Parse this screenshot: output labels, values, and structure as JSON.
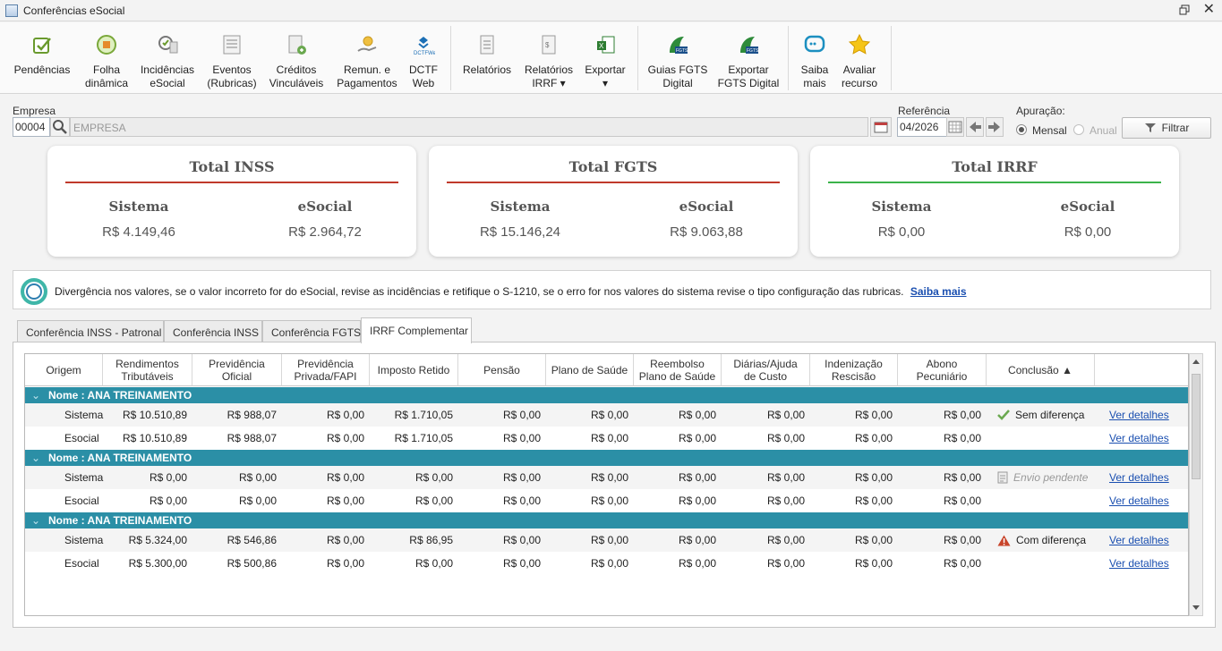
{
  "window": {
    "title": "Conferências eSocial"
  },
  "ribbon": [
    {
      "id": "pendencias",
      "lines": [
        "Pendências"
      ],
      "icon": "pending-check-icon"
    },
    {
      "id": "folha",
      "lines": [
        "Folha",
        "dinâmica"
      ],
      "icon": "payroll-icon"
    },
    {
      "id": "incidencias",
      "lines": [
        "Incidências",
        "eSocial"
      ],
      "icon": "incidence-icon"
    },
    {
      "id": "eventos",
      "lines": [
        "Eventos",
        "(Rubricas)"
      ],
      "icon": "events-list-icon"
    },
    {
      "id": "creditos",
      "lines": [
        "Créditos",
        "Vinculáveis"
      ],
      "icon": "credits-doc-icon"
    },
    {
      "id": "remun",
      "lines": [
        "Remun. e",
        "Pagamentos"
      ],
      "icon": "payment-hand-icon"
    },
    {
      "id": "dctf",
      "lines": [
        "DCTF",
        "Web"
      ],
      "icon": "dctfweb-icon"
    },
    {
      "id": "relatorios",
      "lines": [
        "Relatórios"
      ],
      "icon": "report-icon"
    },
    {
      "id": "relatorios_irrf",
      "lines": [
        "Relatórios",
        "IRRF ▾"
      ],
      "icon": "report-irrf-icon"
    },
    {
      "id": "exportar",
      "lines": [
        "Exportar",
        "▾"
      ],
      "icon": "excel-export-icon"
    },
    {
      "id": "guias_fgts",
      "lines": [
        "Guias FGTS",
        "Digital"
      ],
      "icon": "fgts-guide-icon"
    },
    {
      "id": "exportar_fgts",
      "lines": [
        "Exportar",
        "FGTS Digital"
      ],
      "icon": "fgts-export-icon"
    },
    {
      "id": "saiba",
      "lines": [
        "Saiba",
        "mais"
      ],
      "icon": "chat-info-icon"
    },
    {
      "id": "avaliar",
      "lines": [
        "Avaliar",
        "recurso"
      ],
      "icon": "star-icon"
    }
  ],
  "filters": {
    "empresa_label": "Empresa",
    "empresa_code": "00004",
    "empresa_name": "EMPRESA",
    "referencia_label": "Referência",
    "referencia_value": "04/2026",
    "apuracao_label": "Apuração:",
    "mensal_label": "Mensal",
    "anual_label": "Anual",
    "filtrar_label": "Filtrar"
  },
  "cards": [
    {
      "title": "Total INSS",
      "line_color": "#c0392b",
      "sistema_label": "Sistema",
      "esocial_label": "eSocial",
      "sistema": "R$ 4.149,46",
      "esocial": "R$ 2.964,72"
    },
    {
      "title": "Total FGTS",
      "line_color": "#c0392b",
      "sistema_label": "Sistema",
      "esocial_label": "eSocial",
      "sistema": "R$ 15.146,24",
      "esocial": "R$ 9.063,88"
    },
    {
      "title": "Total IRRF",
      "line_color": "#3bb34a",
      "sistema_label": "Sistema",
      "esocial_label": "eSocial",
      "sistema": "R$ 0,00",
      "esocial": "R$ 0,00"
    }
  ],
  "alert": {
    "message": "Divergência nos valores, se o valor incorreto for do eSocial, revise as incidências e retifique o S-1210, se o erro for nos valores do sistema revise o tipo configuração das rubricas.",
    "link": "Saiba mais"
  },
  "tabs": [
    "Conferência INSS - Patronal",
    "Conferência INSS",
    "Conferência FGTS",
    "IRRF Complementar"
  ],
  "active_tab": 3,
  "grid": {
    "columns": [
      [
        "Origem"
      ],
      [
        "Rendimentos",
        "Tributáveis"
      ],
      [
        "Previdência",
        "Oficial"
      ],
      [
        "Previdência",
        "Privada/FAPI"
      ],
      [
        "Imposto Retido"
      ],
      [
        "Pensão"
      ],
      [
        "Plano de Saúde"
      ],
      [
        "Reembolso",
        "Plano de Saúde"
      ],
      [
        "Diárias/Ajuda",
        "de Custo"
      ],
      [
        "Indenização",
        "Rescisão"
      ],
      [
        "Abono",
        "Pecuniário"
      ],
      [
        "Conclusão ▲"
      ],
      [
        ""
      ]
    ],
    "groups": [
      {
        "label": "Nome : ANA TREINAMENTO",
        "conclusion": "Sem diferença",
        "conclusion_type": "ok",
        "rows": [
          {
            "origem": "Sistema",
            "values": [
              "R$ 10.510,89",
              "R$ 988,07",
              "R$ 0,00",
              "R$ 1.710,05",
              "R$ 0,00",
              "R$ 0,00",
              "R$ 0,00",
              "R$ 0,00",
              "R$ 0,00",
              "R$ 0,00"
            ],
            "link": "Ver detalhes"
          },
          {
            "origem": "Esocial",
            "values": [
              "R$ 10.510,89",
              "R$ 988,07",
              "R$ 0,00",
              "R$ 1.710,05",
              "R$ 0,00",
              "R$ 0,00",
              "R$ 0,00",
              "R$ 0,00",
              "R$ 0,00",
              "R$ 0,00"
            ],
            "link": "Ver detalhes"
          }
        ]
      },
      {
        "label": "Nome : ANA TREINAMENTO",
        "conclusion": "Envio pendente",
        "conclusion_type": "pending",
        "rows": [
          {
            "origem": "Sistema",
            "values": [
              "R$ 0,00",
              "R$  0,00",
              "R$ 0,00",
              "R$ 0,00",
              "R$ 0,00",
              "R$ 0,00",
              "R$ 0,00",
              "R$ 0,00",
              "R$ 0,00",
              "R$ 0,00"
            ],
            "link": "Ver detalhes"
          },
          {
            "origem": "Esocial",
            "values": [
              "R$ 0,00",
              "R$  0,00",
              "R$ 0,00",
              "R$ 0,00",
              "R$ 0,00",
              "R$ 0,00",
              "R$ 0,00",
              "R$ 0,00",
              "R$ 0,00",
              "R$ 0,00"
            ],
            "link": "Ver detalhes"
          }
        ]
      },
      {
        "label": "Nome : ANA TREINAMENTO",
        "conclusion": "Com diferença",
        "conclusion_type": "warn",
        "rows": [
          {
            "origem": "Sistema",
            "values": [
              "R$ 5.324,00",
              "R$ 546,86",
              "R$ 0,00",
              "R$ 86,95",
              "R$ 0,00",
              "R$ 0,00",
              "R$ 0,00",
              "R$ 0,00",
              "R$ 0,00",
              "R$ 0,00"
            ],
            "link": "Ver detalhes"
          },
          {
            "origem": "Esocial",
            "values": [
              "R$ 5.300,00",
              "R$ 500,86",
              "R$ 0,00",
              "R$ 0,00",
              "R$ 0,00",
              "R$ 0,00",
              "R$ 0,00",
              "R$ 0,00",
              "R$ 0,00",
              "R$ 0,00"
            ],
            "link": "Ver detalhes"
          }
        ]
      }
    ]
  }
}
